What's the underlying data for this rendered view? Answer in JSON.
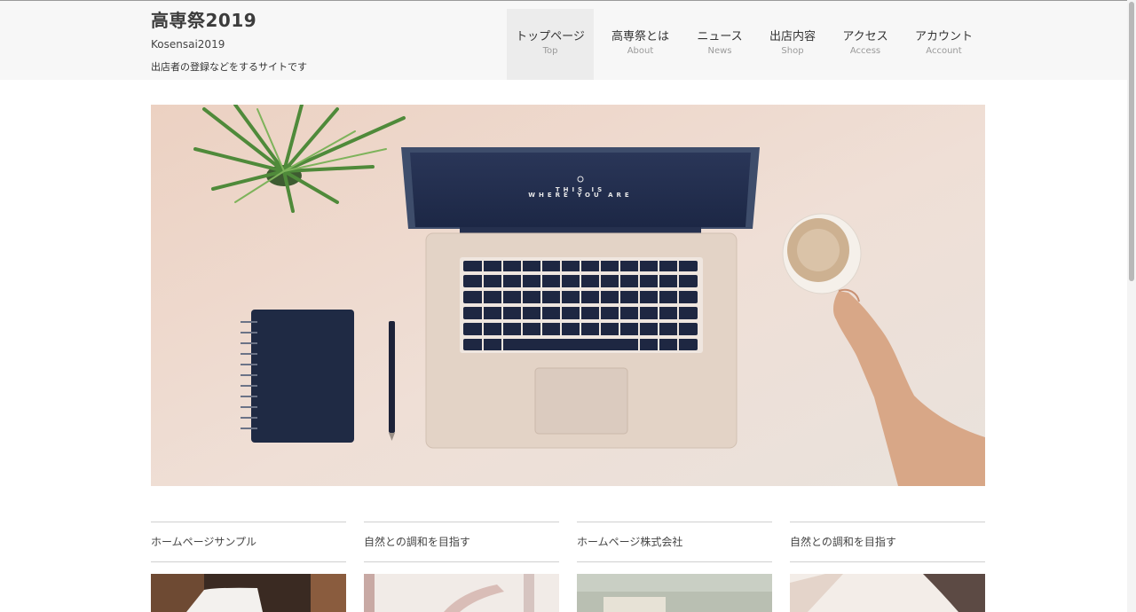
{
  "site": {
    "title": "高専祭2019",
    "subtitle": "Kosensai2019",
    "description": "出店者の登録などをするサイトです"
  },
  "nav": {
    "items": [
      {
        "label": "トップページ",
        "sub": "Top",
        "active": true
      },
      {
        "label": "高専祭とは",
        "sub": "About",
        "active": false
      },
      {
        "label": "ニュース",
        "sub": "News",
        "active": false
      },
      {
        "label": "出店内容",
        "sub": "Shop",
        "active": false
      },
      {
        "label": "アクセス",
        "sub": "Access",
        "active": false
      },
      {
        "label": "アカウント",
        "sub": "Account",
        "active": false
      }
    ]
  },
  "hero": {
    "screen_text_line1": "THIS IS",
    "screen_text_line2": "WHERE YOU ARE"
  },
  "cards": [
    {
      "title": "ホームページサンプル"
    },
    {
      "title": "自然との調和を目指す"
    },
    {
      "title": "ホームページ株式会社"
    },
    {
      "title": "自然との調和を目指す"
    }
  ],
  "colors": {
    "header_bg": "#f7f7f7",
    "active_nav_bg": "#ececec",
    "hero_bg": "#efd9cc",
    "text": "#333333",
    "muted": "#9a9a9a"
  }
}
